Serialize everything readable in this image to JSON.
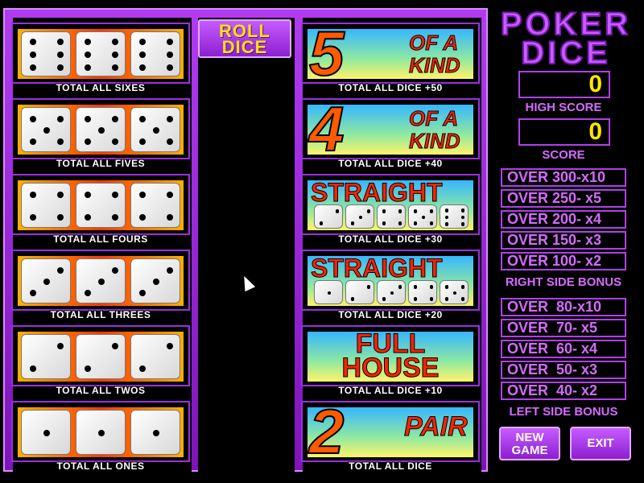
{
  "game": {
    "title_line1": "POKER",
    "title_line2": "DICE",
    "roll_button_line1": "ROLL",
    "roll_button_line2": "DICE"
  },
  "left_rows": [
    {
      "label": "TOTAL ALL SIXES",
      "face": 6
    },
    {
      "label": "TOTAL ALL FIVES",
      "face": 5
    },
    {
      "label": "TOTAL ALL FOURS",
      "face": 4
    },
    {
      "label": "TOTAL ALL THREES",
      "face": 3
    },
    {
      "label": "TOTAL ALL TWOS",
      "face": 2
    },
    {
      "label": "TOTAL ALL ONES",
      "face": 1
    }
  ],
  "right_rows": [
    {
      "label": "TOTAL ALL DICE +50",
      "big": "5",
      "words": [
        "OF A",
        "KIND"
      ]
    },
    {
      "label": "TOTAL ALL DICE +40",
      "big": "4",
      "words": [
        "OF A",
        "KIND"
      ]
    },
    {
      "label": "TOTAL ALL DICE +30",
      "word": "STRAIGHT",
      "dice": [
        2,
        3,
        4,
        5,
        6
      ]
    },
    {
      "label": "TOTAL ALL DICE +20",
      "word": "STRAIGHT",
      "dice": [
        1,
        2,
        3,
        4,
        5
      ]
    },
    {
      "label": "TOTAL ALL DICE +10",
      "word1": "FULL",
      "word2": "HOUSE"
    },
    {
      "label": "TOTAL ALL DICE",
      "big": "2",
      "words": [
        "PAIR"
      ]
    }
  ],
  "scores": {
    "high_score_value": "0",
    "high_score_label": "HIGH SCORE",
    "score_value": "0",
    "score_label": "SCORE"
  },
  "right_bonus": {
    "items": [
      "OVER 300-x10",
      "OVER 250- x5",
      "OVER 200- x4",
      "OVER 150- x3",
      "OVER 100- x2"
    ],
    "label": "RIGHT SIDE BONUS"
  },
  "left_bonus": {
    "items": [
      "OVER  80-x10",
      "OVER  70- x5",
      "OVER  60- x4",
      "OVER  50- x3",
      "OVER  40- x2"
    ],
    "label": "LEFT SIDE BONUS"
  },
  "buttons": {
    "new_game_line1": "NEW",
    "new_game_line2": "GAME",
    "exit": "EXIT"
  },
  "colors": {
    "board": "#9a2ee0",
    "accent": "#ffe600",
    "text_purple": "#d56bff"
  }
}
